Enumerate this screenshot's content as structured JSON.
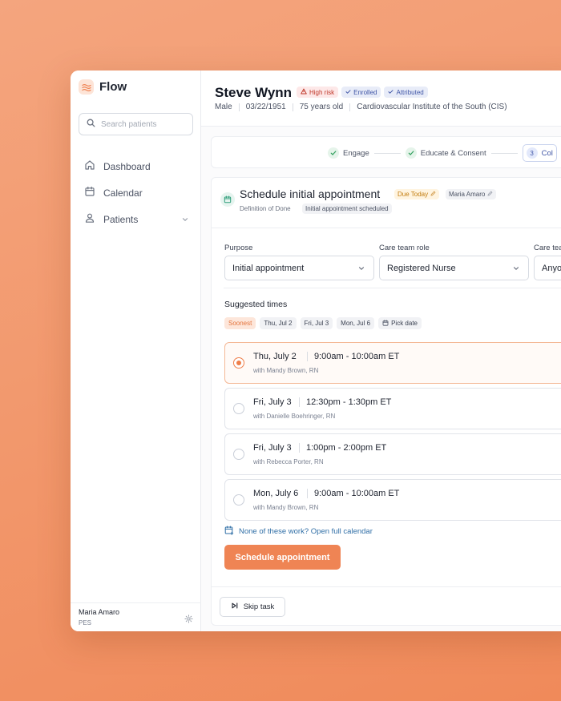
{
  "app": {
    "name": "Flow"
  },
  "sidebar": {
    "search_placeholder": "Search patients",
    "items": [
      {
        "label": "Dashboard",
        "icon": "home-icon"
      },
      {
        "label": "Calendar",
        "icon": "calendar-icon"
      },
      {
        "label": "Patients",
        "icon": "user-icon"
      }
    ],
    "user": {
      "name": "Maria Amaro",
      "role": "PES"
    }
  },
  "patient": {
    "name": "Steve Wynn",
    "badges": {
      "risk": "High risk",
      "enrolled": "Enrolled",
      "attributed": "Attributed"
    },
    "sex": "Male",
    "dob": "03/22/1951",
    "age": "75 years old",
    "institute": "Cardiovascular Institute of the South (CIS)"
  },
  "stepper": {
    "steps": [
      {
        "label": "Engage",
        "state": "done"
      },
      {
        "label": "Educate & Consent",
        "state": "done"
      },
      {
        "number": "3",
        "label": "Col",
        "state": "current"
      }
    ]
  },
  "task": {
    "title": "Schedule initial appointment",
    "due": "Due Today",
    "assignee": "Maria Amaro",
    "dod_label": "Definition of Done",
    "dod_value": "Initial appointment scheduled",
    "fields": {
      "purpose_label": "Purpose",
      "purpose_value": "Initial appointment",
      "role_label": "Care team role",
      "role_value": "Registered Nurse",
      "member_label": "Care tea",
      "member_value": "Anyo"
    },
    "suggested_label": "Suggested times",
    "chips": [
      "Soonest",
      "Thu, Jul 2",
      "Fri, Jul 3",
      "Mon, Jul 6",
      "Pick date"
    ],
    "slots": [
      {
        "date": "Thu, July 2",
        "time": "9:00am - 10:00am ET",
        "with": "with Mandy Brown, RN"
      },
      {
        "date": "Fri, July 3",
        "time": "12:30pm - 1:30pm ET",
        "with": "with Danielle Boehringer, RN"
      },
      {
        "date": "Fri, July 3",
        "time": "1:00pm - 2:00pm ET",
        "with": "with Rebecca Porter, RN"
      },
      {
        "date": "Mon, July 6",
        "time": "9:00am - 10:00am ET",
        "with": "with Mandy Brown, RN"
      }
    ],
    "calendar_link": "None of these work? Open full calendar",
    "schedule_button": "Schedule appointment",
    "skip_button": "Skip task"
  },
  "colors": {
    "accent": "#ef8454",
    "link": "#2f6ea6",
    "risk": "#c0392b",
    "info": "#3f55a6"
  }
}
